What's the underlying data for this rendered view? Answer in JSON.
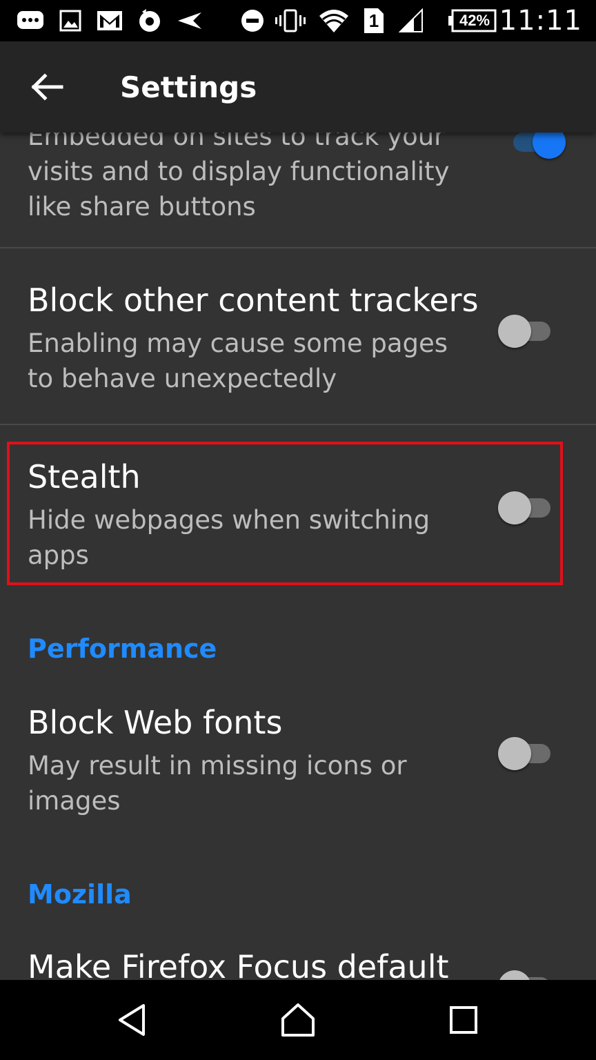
{
  "status_bar": {
    "battery": "42%",
    "time": "11:11",
    "sim_slot": "1",
    "icons": [
      "chat-icon",
      "image-icon",
      "gmail-icon",
      "firefox-focus-icon",
      "send-icon",
      "do-not-disturb-icon",
      "vibrate-icon",
      "wifi-icon",
      "sim-icon",
      "signal-icon",
      "battery-icon"
    ]
  },
  "app_bar": {
    "title": "Settings",
    "back_icon": "arrow-left-icon"
  },
  "settings": {
    "partial_item": {
      "subtitle_lines": [
        "Embedded on sites to track your",
        "visits and to display functionality",
        "like share buttons"
      ],
      "enabled": true
    },
    "block_other": {
      "title": "Block other content trackers",
      "subtitle_1": "Enabling may cause some pages",
      "subtitle_2": "to behave unexpectedly",
      "enabled": false
    },
    "stealth": {
      "title": "Stealth",
      "subtitle_1": "Hide webpages when switching",
      "subtitle_2": "apps",
      "enabled": false
    },
    "performance_header": "Performance",
    "block_fonts": {
      "title": "Block Web fonts",
      "subtitle_1": "May result in missing icons or",
      "subtitle_2": "images",
      "enabled": false
    },
    "mozilla_header": "Mozilla",
    "default_browser": {
      "title": "Make Firefox Focus default",
      "enabled": false
    }
  },
  "colors": {
    "accent": "#1f8bff",
    "background": "#333333",
    "highlight_border": "#e0101a",
    "switch_on": "#1776f5"
  },
  "nav_bar": {
    "icons": [
      "back-triangle-icon",
      "home-icon",
      "recents-icon"
    ]
  }
}
